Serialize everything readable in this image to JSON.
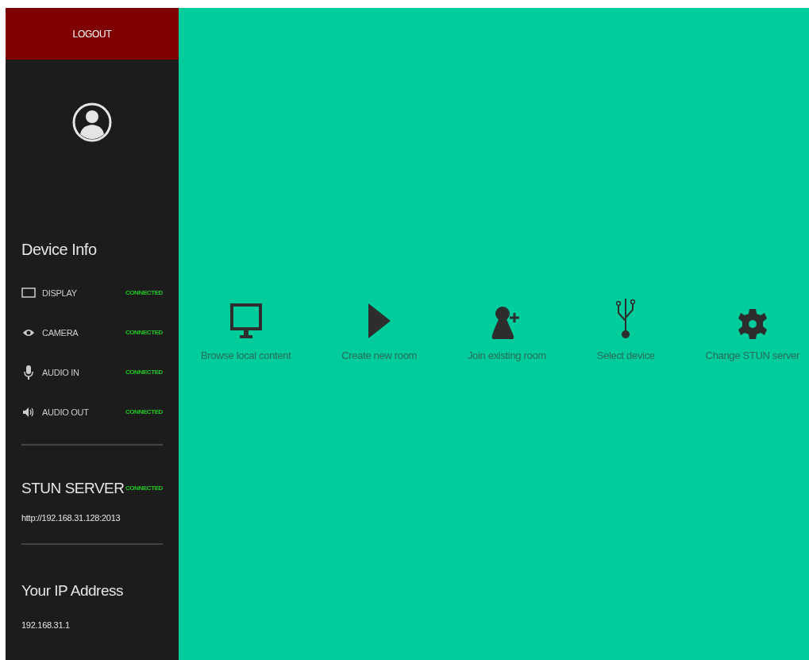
{
  "sidebar": {
    "logout_button": "LOGOUT",
    "device_info": {
      "title": "Device Info",
      "devices": [
        {
          "kind": "display",
          "label": "DISPLAY",
          "status": "CONNECTED"
        },
        {
          "kind": "camera",
          "label": "CAMERA",
          "status": "CONNECTED"
        },
        {
          "kind": "mic",
          "label": "AUDIO IN",
          "status": "CONNECTED"
        },
        {
          "kind": "speaker",
          "label": "AUDIO OUT",
          "status": "CONNECTED"
        }
      ]
    },
    "stun_server": {
      "title": "STUN SERVER",
      "status": "CONNECTED",
      "url": "http://192.168.31.128:2013"
    },
    "ip_address": {
      "title": "Your IP Address",
      "value": "192.168.31.1"
    }
  },
  "actions": [
    {
      "kind": "monitor",
      "label": "Browse local content"
    },
    {
      "kind": "play",
      "label": "Create new room"
    },
    {
      "kind": "add-user",
      "label": "Join existing room"
    },
    {
      "kind": "usb",
      "label": "Select device"
    },
    {
      "kind": "gear",
      "label": "Change STUN server"
    }
  ]
}
